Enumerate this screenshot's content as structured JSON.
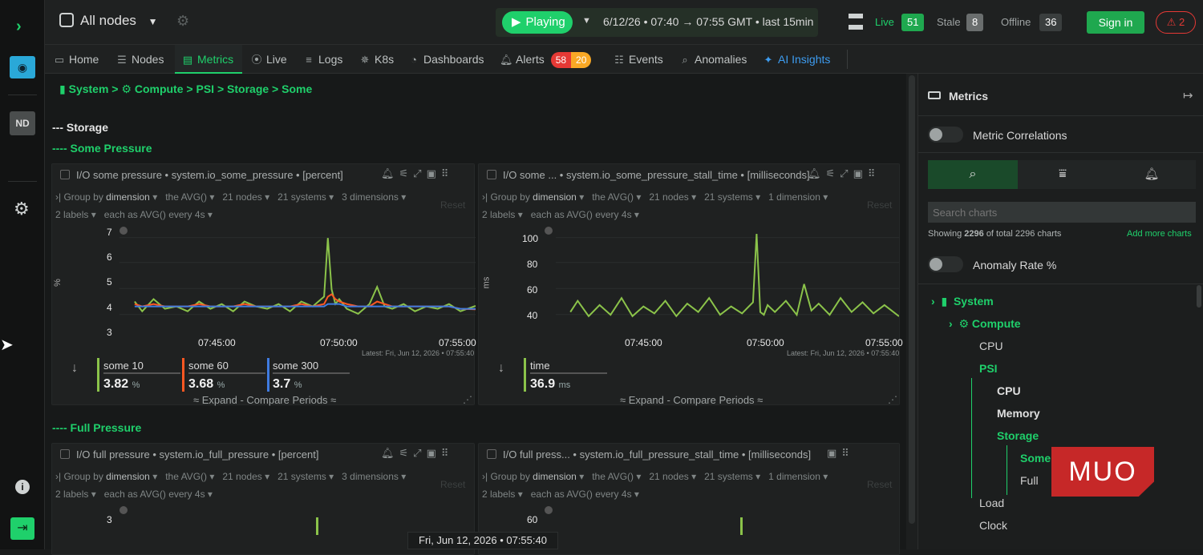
{
  "topbar": {
    "nodes_selector": "All nodes",
    "play_label": "Playing",
    "time_range": "6/12/26 • 07:40 → 07:55 GMT • last  15min",
    "live_label": "Live",
    "live_count": "51",
    "stale_label": "Stale",
    "stale_count": "8",
    "offline_label": "Offline",
    "offline_count": "36",
    "signin_label": "Sign in",
    "alert_count": "2"
  },
  "leftbar": {
    "avatar": "ND"
  },
  "tabs": [
    {
      "label": "Home",
      "icon": "home-icon"
    },
    {
      "label": "Nodes",
      "icon": "nodes-icon"
    },
    {
      "label": "Metrics",
      "icon": "metrics-icon"
    },
    {
      "label": "Live",
      "icon": "live-icon"
    },
    {
      "label": "Logs",
      "icon": "logs-icon"
    },
    {
      "label": "K8s",
      "icon": "k8s-icon"
    },
    {
      "label": "Dashboards",
      "icon": "dashboards-icon"
    },
    {
      "label": "Alerts",
      "icon": "bell-icon"
    },
    {
      "label": "Events",
      "icon": "events-icon"
    },
    {
      "label": "Anomalies",
      "icon": "anomalies-icon"
    },
    {
      "label": "AI Insights",
      "icon": "sparkle-icon"
    }
  ],
  "alerts_badge": {
    "critical": "58",
    "warning": "20"
  },
  "breadcrumb": [
    "System",
    "Compute",
    "PSI",
    "Storage",
    "Some"
  ],
  "sections": {
    "storage": "--- Storage",
    "some": "---- Some Pressure",
    "full": "---- Full Pressure"
  },
  "charts": [
    {
      "title": "I/O some pressure • system.io_some_pressure • [percent]",
      "group_by_label": "Group by",
      "group_by_value": "dimension",
      "agg": "the AVG()",
      "nodes": "21 nodes",
      "systems": "21 systems",
      "dims": "3 dimensions",
      "labels": "2 labels",
      "each": "each as AVG() every 4s",
      "reset": "Reset",
      "unit": "%",
      "y_ticks": [
        "7",
        "6",
        "5",
        "4",
        "3"
      ],
      "x_ticks": [
        "07:45:00",
        "07:50:00",
        "07:55:00"
      ],
      "latest": "Latest:  Fri, Jun 12, 2026 • 07:55:40",
      "legend": [
        {
          "name": "some 10",
          "value": "3.82",
          "unit": "%",
          "color": "#8bc34a"
        },
        {
          "name": "some 60",
          "value": "3.68",
          "unit": "%",
          "color": "#ff5722"
        },
        {
          "name": "some 300",
          "value": "3.7",
          "unit": "%",
          "color": "#3f7be0"
        }
      ],
      "expand": "≈ Expand - Compare Periods ≈"
    },
    {
      "title": "I/O some ...  • system.io_some_pressure_stall_time • [milliseconds]",
      "group_by_label": "Group by",
      "group_by_value": "dimension",
      "agg": "the AVG()",
      "nodes": "21 nodes",
      "systems": "21 systems",
      "dims": "1 dimension",
      "labels": "2 labels",
      "each": "each as AVG() every 4s",
      "reset": "Reset",
      "unit": "ms",
      "y_ticks": [
        "100",
        "80",
        "60",
        "40"
      ],
      "x_ticks": [
        "07:45:00",
        "07:50:00",
        "07:55:00"
      ],
      "latest": "Latest:  Fri, Jun 12, 2026 • 07:55:40",
      "legend": [
        {
          "name": "time",
          "value": "36.9",
          "unit": "ms",
          "color": "#8bc34a"
        }
      ],
      "expand": "≈ Expand - Compare Periods ≈"
    },
    {
      "title": "I/O full pressure • system.io_full_pressure • [percent]",
      "group_by_label": "Group by",
      "group_by_value": "dimension",
      "agg": "the AVG()",
      "nodes": "21 nodes",
      "systems": "21 systems",
      "dims": "3 dimensions",
      "labels": "2 labels",
      "each": "each as AVG() every 4s",
      "reset": "Reset",
      "y_ticks": [
        "3"
      ]
    },
    {
      "title": "I/O full press... • system.io_full_pressure_stall_time • [milliseconds]",
      "group_by_label": "Group by",
      "group_by_value": "dimension",
      "agg": "the AVG()",
      "nodes": "21 nodes",
      "systems": "21 systems",
      "dims": "1 dimension",
      "labels": "2 labels",
      "each": "each as AVG() every 4s",
      "reset": "Reset",
      "y_ticks": [
        "60"
      ]
    }
  ],
  "tooltip_time": "Fri, Jun 12, 2026 • 07:55:40",
  "rightpanel": {
    "title": "Metrics",
    "correlations_label": "Metric Correlations",
    "search_placeholder": "Search charts",
    "showing_prefix": "Showing",
    "showing_count": "2296",
    "showing_mid": "of total",
    "showing_total": "2296",
    "showing_suffix": "charts",
    "add_more": "Add more charts",
    "anomaly_label": "Anomaly Rate %",
    "tree": {
      "system": "System",
      "compute": "Compute",
      "cpu": "CPU",
      "psi": "PSI",
      "psi_cpu": "CPU",
      "memory": "Memory",
      "storage": "Storage",
      "some": "Some",
      "full": "Full",
      "load": "Load",
      "clock": "Clock"
    }
  },
  "watermark": "MUO",
  "colors": {
    "accent": "#1fd06b",
    "series_green": "#8bc34a",
    "series_orange": "#ff5722",
    "series_blue": "#3f7be0",
    "alert_red": "#e53935",
    "alert_orange": "#f9a825"
  },
  "chart_data": [
    {
      "type": "line",
      "ylabel": "%",
      "ylim": [
        3,
        7
      ],
      "x": [
        "07:40:40",
        "07:41:00",
        "07:41:30",
        "07:42:00",
        "07:42:30",
        "07:43:00",
        "07:43:30",
        "07:44:00",
        "07:44:30",
        "07:45:00",
        "07:45:30",
        "07:46:00",
        "07:46:30",
        "07:47:00",
        "07:47:30",
        "07:48:00",
        "07:48:30",
        "07:49:00",
        "07:49:10",
        "07:49:20",
        "07:49:30",
        "07:49:40",
        "07:50:00",
        "07:50:30",
        "07:51:00",
        "07:51:20",
        "07:51:40",
        "07:52:00",
        "07:52:30",
        "07:53:00",
        "07:53:30",
        "07:54:00",
        "07:54:30",
        "07:55:00",
        "07:55:40"
      ],
      "series": [
        {
          "name": "some 10",
          "values": [
            4.0,
            3.6,
            4.1,
            3.7,
            3.8,
            3.6,
            4.0,
            3.7,
            3.9,
            3.6,
            4.0,
            3.8,
            3.7,
            3.9,
            3.6,
            4.0,
            3.8,
            4.2,
            6.6,
            4.5,
            3.9,
            4.1,
            3.7,
            3.5,
            3.9,
            4.6,
            3.8,
            3.7,
            3.9,
            3.6,
            3.8,
            3.7,
            3.9,
            3.6,
            3.82
          ]
        },
        {
          "name": "some 60",
          "values": [
            3.9,
            3.8,
            3.9,
            3.8,
            3.8,
            3.8,
            3.9,
            3.8,
            3.8,
            3.8,
            3.9,
            3.8,
            3.8,
            3.8,
            3.8,
            3.9,
            3.8,
            3.9,
            4.2,
            4.3,
            4.1,
            4.0,
            3.9,
            3.8,
            3.8,
            4.0,
            3.9,
            3.8,
            3.8,
            3.8,
            3.8,
            3.8,
            3.8,
            3.7,
            3.68
          ]
        },
        {
          "name": "some 300",
          "values": [
            3.8,
            3.8,
            3.8,
            3.8,
            3.8,
            3.8,
            3.8,
            3.8,
            3.8,
            3.8,
            3.8,
            3.8,
            3.8,
            3.8,
            3.8,
            3.8,
            3.8,
            3.8,
            3.9,
            3.9,
            3.9,
            3.9,
            3.8,
            3.8,
            3.8,
            3.8,
            3.8,
            3.8,
            3.8,
            3.8,
            3.8,
            3.8,
            3.8,
            3.7,
            3.7
          ]
        }
      ]
    },
    {
      "type": "line",
      "ylabel": "ms",
      "ylim": [
        30,
        100
      ],
      "x": [
        "07:40:40",
        "07:41:00",
        "07:41:30",
        "07:42:00",
        "07:42:30",
        "07:43:00",
        "07:43:30",
        "07:44:00",
        "07:44:30",
        "07:45:00",
        "07:45:30",
        "07:46:00",
        "07:46:30",
        "07:47:00",
        "07:47:30",
        "07:48:00",
        "07:48:30",
        "07:49:00",
        "07:49:10",
        "07:49:20",
        "07:49:30",
        "07:49:40",
        "07:50:00",
        "07:50:30",
        "07:51:00",
        "07:51:20",
        "07:51:40",
        "07:52:00",
        "07:52:30",
        "07:53:00",
        "07:53:30",
        "07:54:00",
        "07:54:30",
        "07:55:00",
        "07:55:40"
      ],
      "series": [
        {
          "name": "time",
          "values": [
            40,
            48,
            37,
            45,
            38,
            50,
            37,
            44,
            39,
            48,
            37,
            46,
            40,
            50,
            38,
            44,
            39,
            47,
            96,
            40,
            38,
            45,
            40,
            48,
            38,
            60,
            41,
            46,
            38,
            50,
            40,
            47,
            39,
            45,
            36.9
          ]
        }
      ]
    }
  ]
}
